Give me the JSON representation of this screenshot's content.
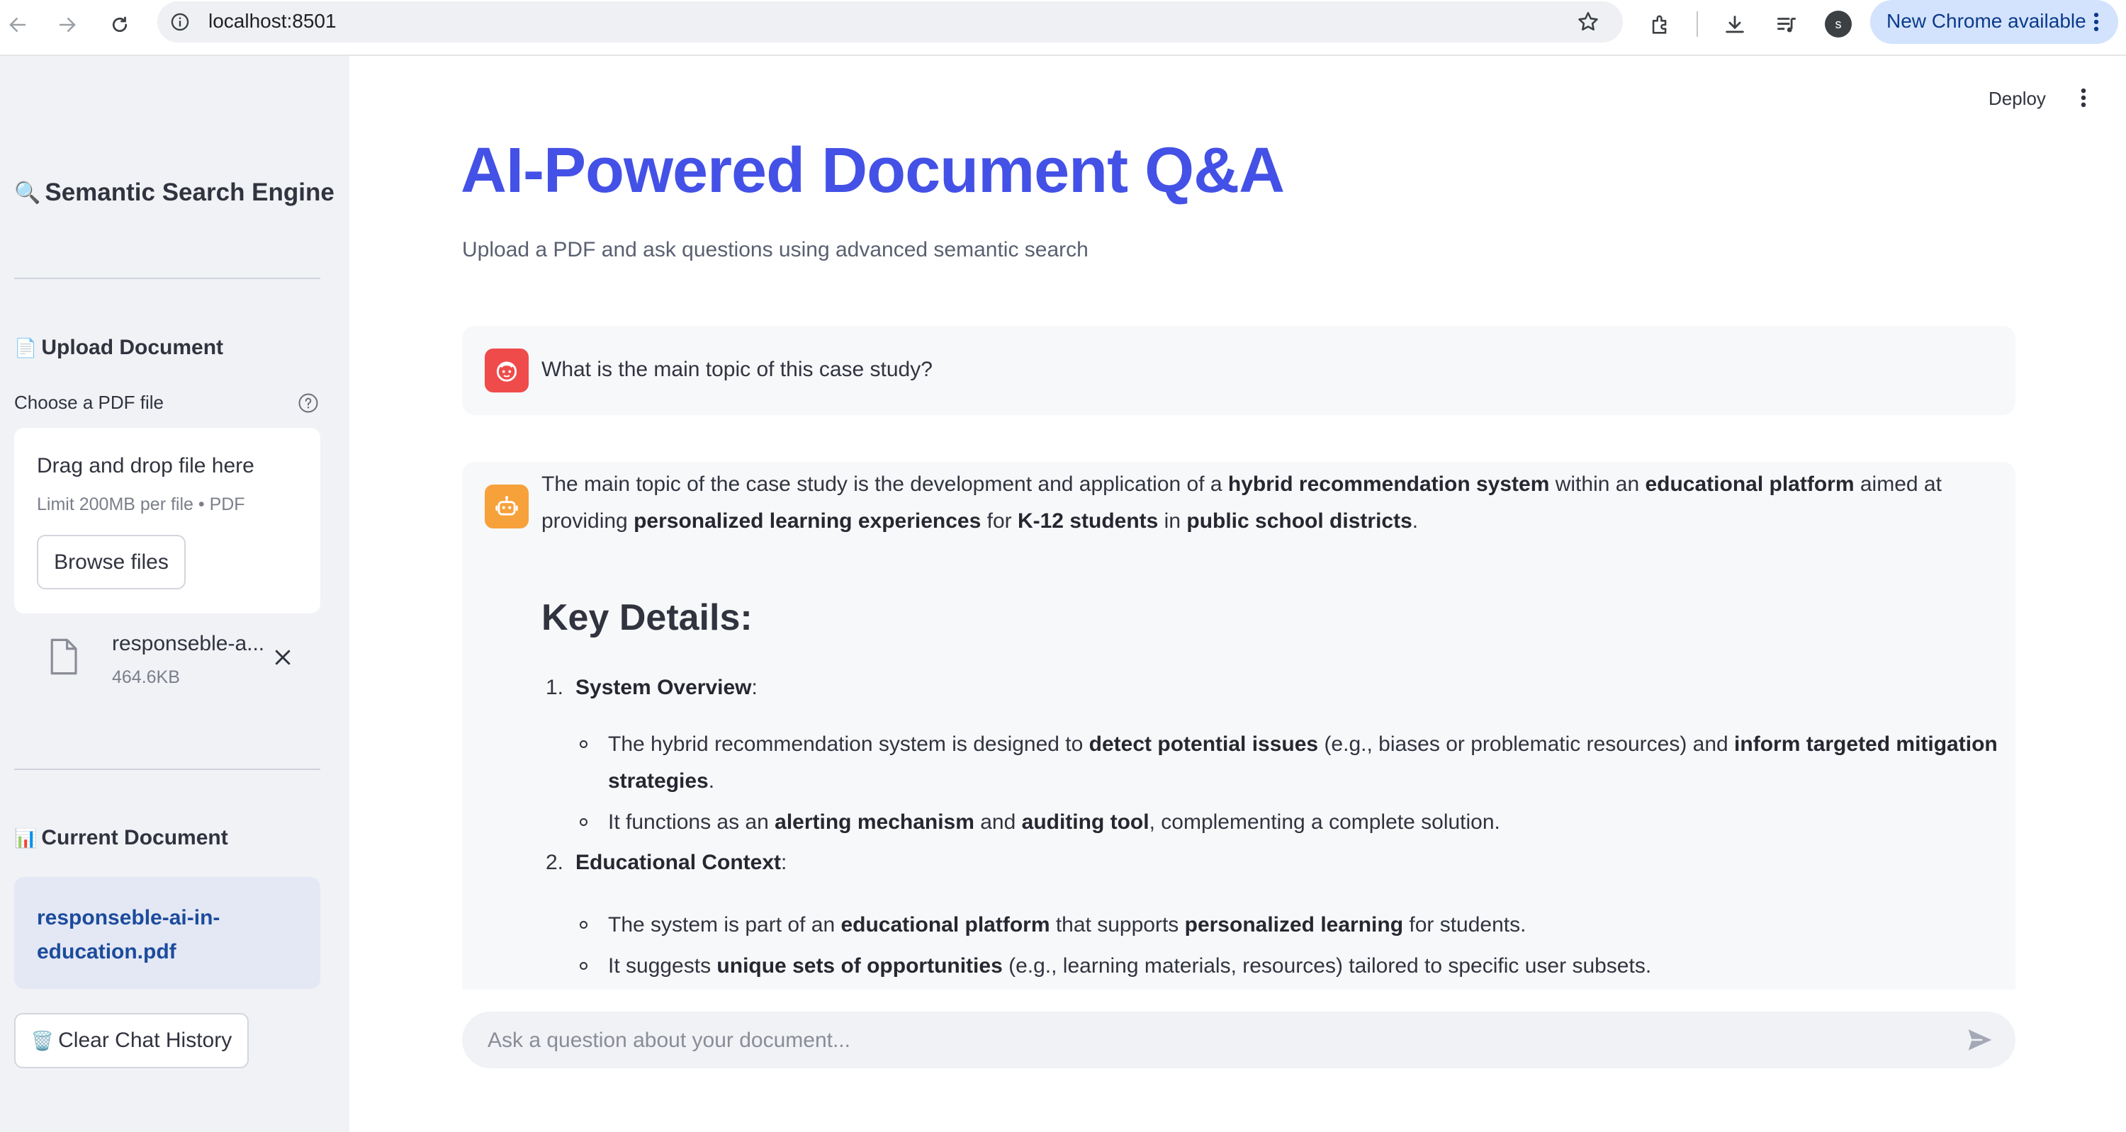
{
  "browser": {
    "url": "localhost:8501",
    "profile_initial": "s",
    "update_label": "New Chrome available"
  },
  "app": {
    "deploy_label": "Deploy"
  },
  "sidebar": {
    "title_icon": "🔍",
    "title": "Semantic Search Engine",
    "upload_icon": "📄",
    "upload_heading": "Upload Document",
    "uploader_label": "Choose a PDF file",
    "dropzone_title": "Drag and drop file here",
    "dropzone_limit": "Limit 200MB per file • PDF",
    "browse_label": "Browse files",
    "file_name": "responseble-a...",
    "file_size": "464.6KB",
    "current_icon": "📊",
    "current_heading": "Current Document",
    "current_doc_line1": "responseble-ai-in-",
    "current_doc_line2": "education.pdf",
    "clear_icon": "🗑️",
    "clear_label": "Clear Chat History"
  },
  "main": {
    "title": "AI-Powered Document Q&A",
    "subtitle": "Upload a PDF and ask questions using advanced semantic search",
    "user_question": "What is the main topic of this case study?",
    "answer": {
      "intro": [
        {
          "t": "The main topic of the case study is the development and application of a "
        },
        {
          "b": "hybrid recommendation system"
        },
        {
          "t": " within an "
        },
        {
          "b": "educational platform"
        },
        {
          "t": " aimed at"
        }
      ],
      "intro2": [
        {
          "t": "providing "
        },
        {
          "b": "personalized learning experiences"
        },
        {
          "t": " for "
        },
        {
          "b": "K-12 students"
        },
        {
          "t": " in "
        },
        {
          "b": "public school districts"
        },
        {
          "t": "."
        }
      ],
      "section_heading": "Key Details:",
      "item1_num": "1.",
      "item1_title": "System Overview",
      "item1_bullet1_a": [
        {
          "t": "The hybrid recommendation system is designed to "
        },
        {
          "b": "detect potential issues"
        },
        {
          "t": " (e.g., biases or problematic resources) and "
        },
        {
          "b": "inform targeted mitigation"
        }
      ],
      "item1_bullet1_b": [
        {
          "b": "strategies"
        },
        {
          "t": "."
        }
      ],
      "item1_bullet2": [
        {
          "t": "It functions as an "
        },
        {
          "b": "alerting mechanism"
        },
        {
          "t": " and "
        },
        {
          "b": "auditing tool"
        },
        {
          "t": ", complementing a complete solution."
        }
      ],
      "item2_num": "2.",
      "item2_title": "Educational Context",
      "item2_bullet1": [
        {
          "t": "The system is part of an "
        },
        {
          "b": "educational platform"
        },
        {
          "t": " that supports "
        },
        {
          "b": "personalized learning"
        },
        {
          "t": " for students."
        }
      ],
      "item2_bullet2": [
        {
          "t": "It suggests "
        },
        {
          "b": "unique sets of opportunities"
        },
        {
          "t": " (e.g., learning materials, resources) tailored to specific user subsets."
        }
      ]
    },
    "chat_placeholder": "Ask a question about your document..."
  },
  "colors": {
    "title": "#4451e6",
    "sidebar_bg": "#f0f2f6",
    "user_avatar": "#ef4b4b",
    "assistant_avatar": "#f7a13b",
    "current_doc_text": "#1c4b9c"
  }
}
